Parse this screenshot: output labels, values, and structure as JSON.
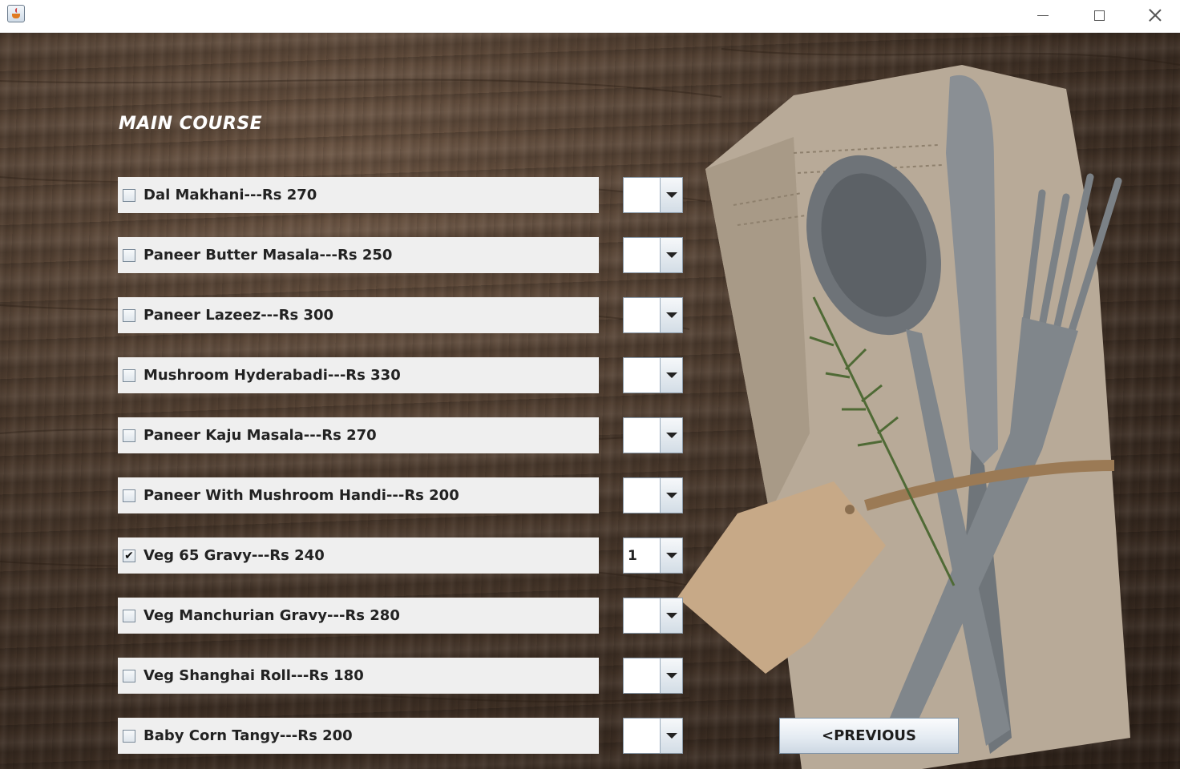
{
  "window": {
    "app_icon": "java-cup-icon",
    "controls": [
      "minimize-icon",
      "maximize-icon",
      "close-icon"
    ]
  },
  "page": {
    "title": "MAIN COURSE"
  },
  "menu_items": [
    {
      "label": "Dal Makhani---Rs 270",
      "checked": false,
      "check_mark": "",
      "qty": ""
    },
    {
      "label": "Paneer Butter Masala---Rs 250",
      "checked": false,
      "check_mark": "",
      "qty": ""
    },
    {
      "label": "Paneer Lazeez---Rs 300",
      "checked": false,
      "check_mark": "",
      "qty": ""
    },
    {
      "label": "Mushroom Hyderabadi---Rs 330",
      "checked": false,
      "check_mark": "",
      "qty": ""
    },
    {
      "label": "Paneer Kaju Masala---Rs 270",
      "checked": false,
      "check_mark": "",
      "qty": ""
    },
    {
      "label": "Paneer With Mushroom Handi---Rs 200",
      "checked": false,
      "check_mark": "",
      "qty": ""
    },
    {
      "label": "Veg 65 Gravy---Rs 240",
      "checked": true,
      "check_mark": "✔",
      "qty": "1"
    },
    {
      "label": "Veg Manchurian Gravy---Rs 280",
      "checked": false,
      "check_mark": "",
      "qty": ""
    },
    {
      "label": "Veg Shanghai Roll---Rs 180",
      "checked": false,
      "check_mark": "",
      "qty": ""
    },
    {
      "label": "Baby Corn Tangy---Rs 200",
      "checked": false,
      "check_mark": "",
      "qty": ""
    }
  ],
  "buttons": {
    "previous_label": "<PREVIOUS"
  },
  "colors": {
    "row_background": "#efefef",
    "title_text": "#ffffff"
  }
}
